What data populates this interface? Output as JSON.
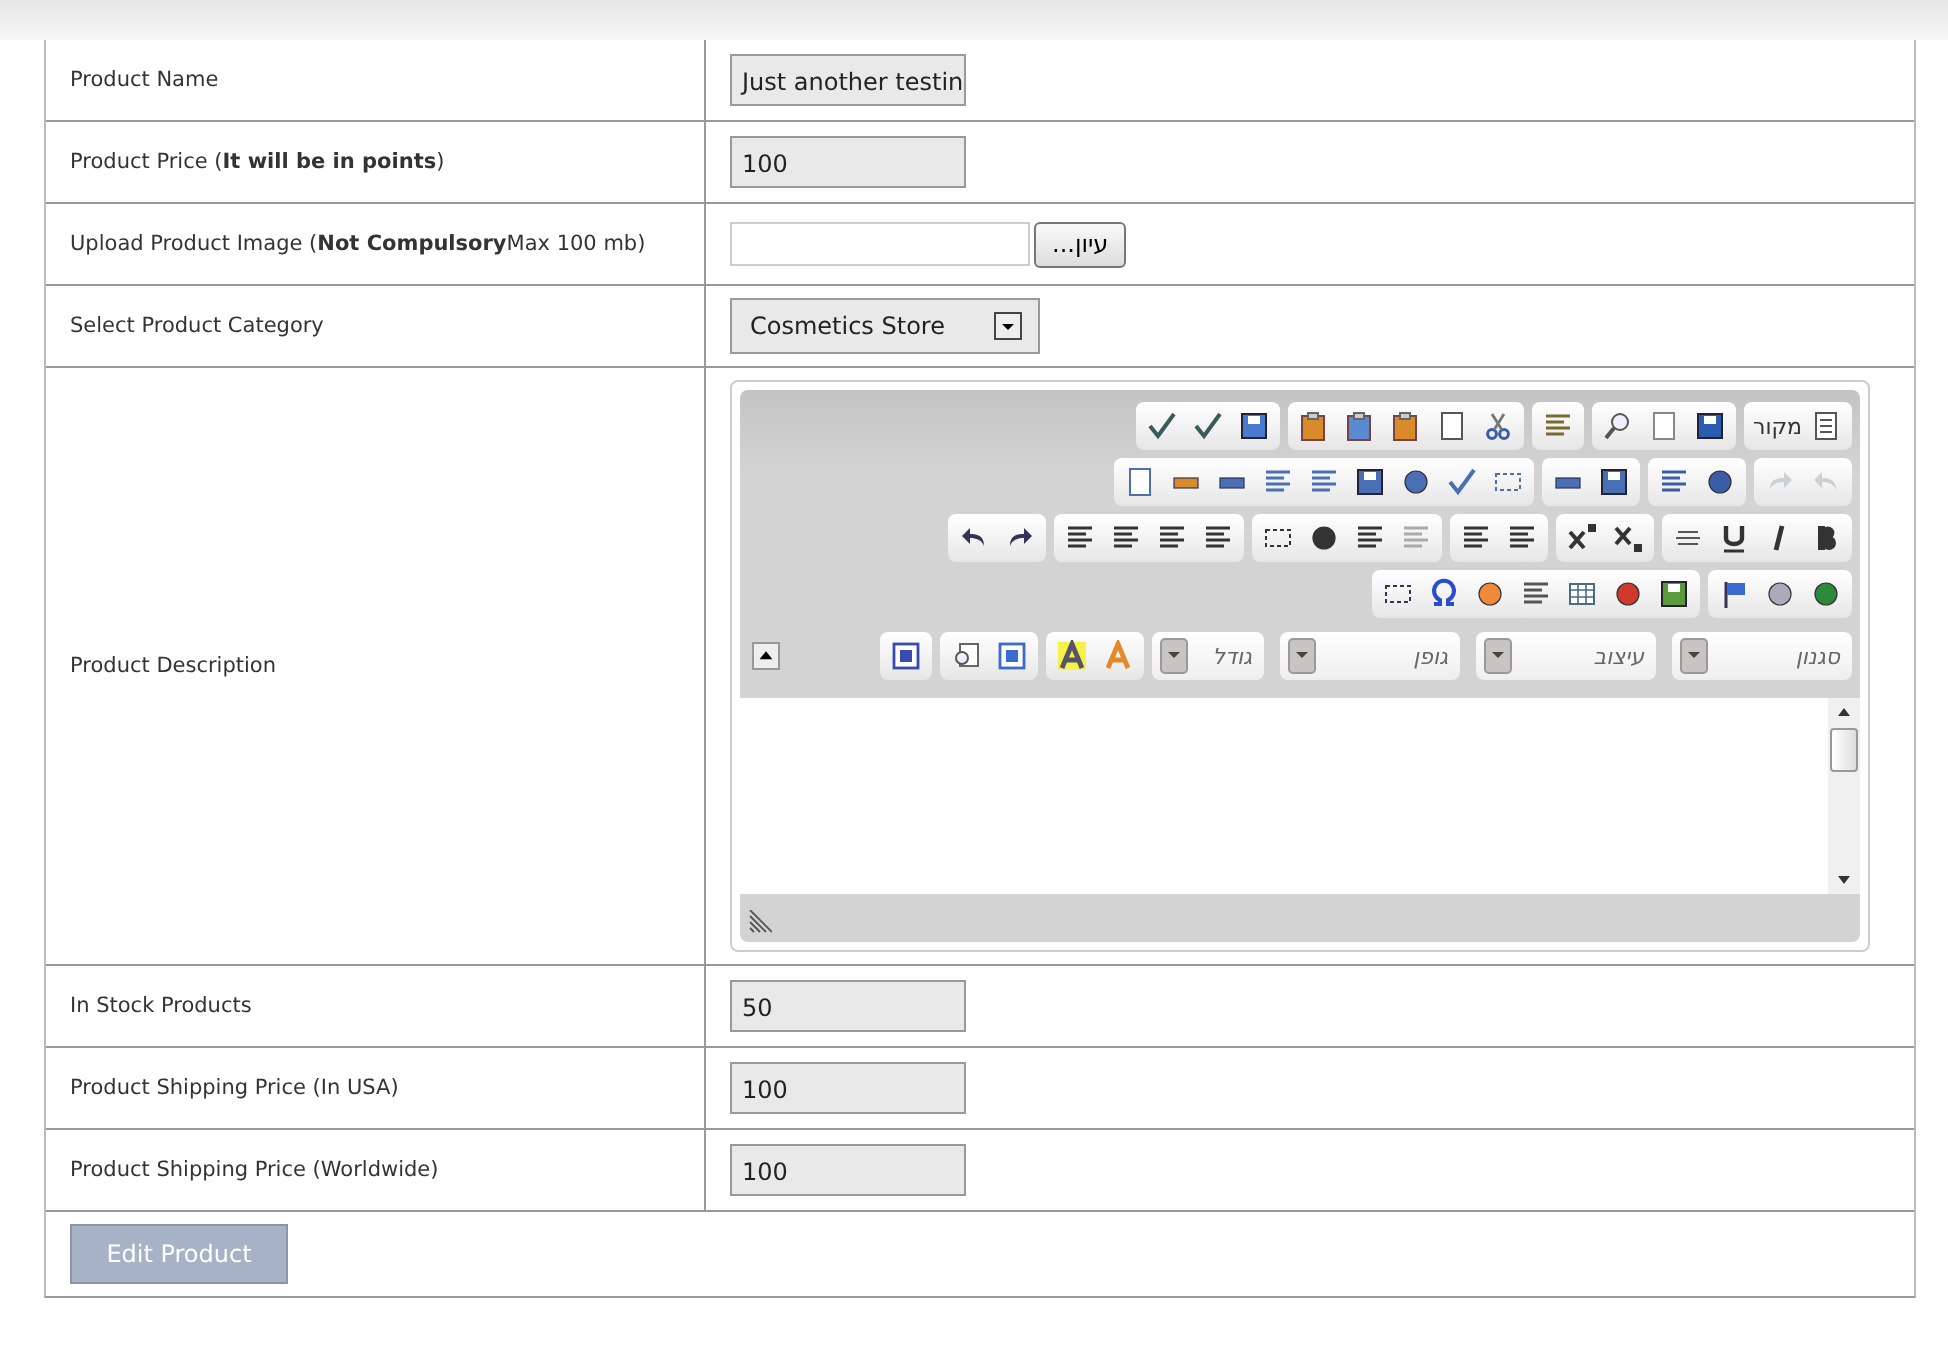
{
  "form": {
    "rows": [
      {
        "kind": "text",
        "label": "Product Name",
        "value": "Just another testin"
      },
      {
        "kind": "text",
        "label": "Product Price (**It will be in points**)",
        "value": "100"
      },
      {
        "kind": "file",
        "label": "Upload Product Image (**Not Compulsory**Max 100 mb)",
        "button": "עיון..."
      },
      {
        "kind": "select",
        "label": "Select Product Category",
        "value": "Cosmetics Store"
      },
      {
        "kind": "editor",
        "label": "Product Description",
        "editor": {
          "source_label": "מקור",
          "history_disabled": true,
          "combos": [
            "סגנון",
            "עיצוב",
            "גופן",
            "גודל"
          ]
        }
      },
      {
        "kind": "text",
        "label": "In Stock Products",
        "value": "50"
      },
      {
        "kind": "text",
        "label": "Product Shipping Price (In USA)",
        "value": "100"
      },
      {
        "kind": "text",
        "label": "Product Shipping Price (Worldwide)",
        "value": "100"
      }
    ],
    "submit": "Edit Product"
  }
}
